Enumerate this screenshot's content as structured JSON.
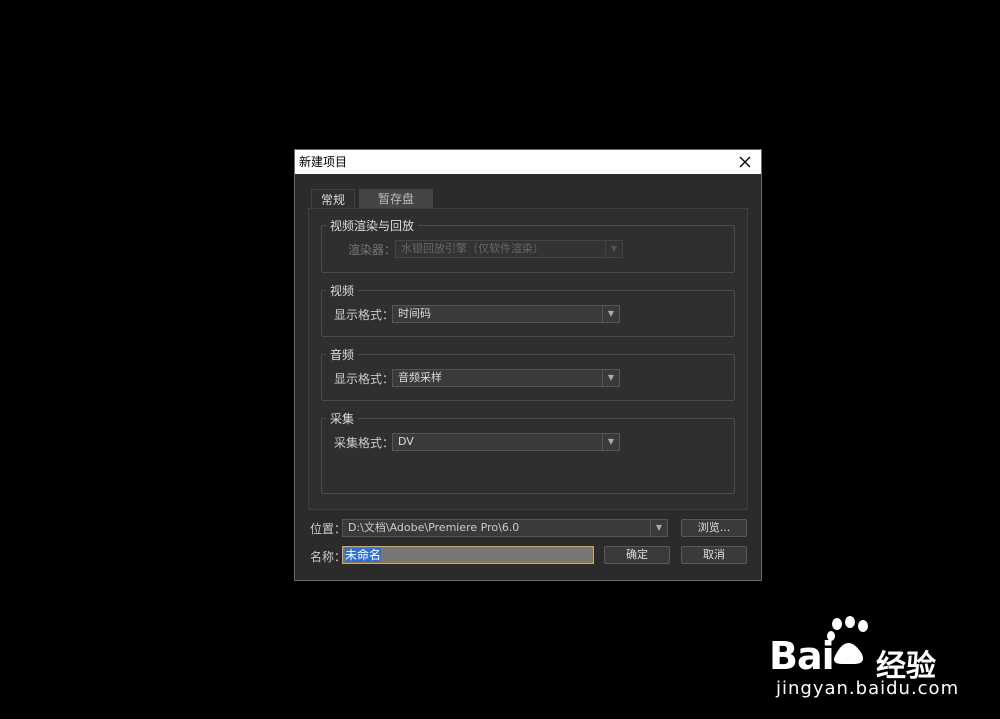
{
  "dialog": {
    "title": "新建项目",
    "tabs": [
      {
        "label": "常规",
        "active": true
      },
      {
        "label": "暂存盘",
        "active": false
      }
    ],
    "groups": {
      "render": {
        "title": "视频渲染与回放",
        "label": "渲染器：",
        "value": "水银回放引擎（仅软件渲染）"
      },
      "video": {
        "title": "视频",
        "label": "显示格式：",
        "value": "时间码"
      },
      "audio": {
        "title": "音频",
        "label": "显示格式：",
        "value": "音频采样"
      },
      "capture": {
        "title": "采集",
        "label": "采集格式：",
        "value": "DV"
      }
    },
    "location_label": "位置：",
    "location_value": "D:\\文档\\Adobe\\Premiere Pro\\6.0",
    "browse_label": "浏览...",
    "name_label": "名称：",
    "name_value": "未命名",
    "ok_label": "确定",
    "cancel_label": "取消"
  },
  "watermark": {
    "brand": "Bai",
    "brand_suffix": "经验",
    "url": "jingyan.baidu.com"
  },
  "colors": {
    "dialog_bg": "#2b2b2b",
    "titlebar_bg": "#ffffff",
    "focus_border": "#d9a94f",
    "selection": "#2f6fd6"
  }
}
